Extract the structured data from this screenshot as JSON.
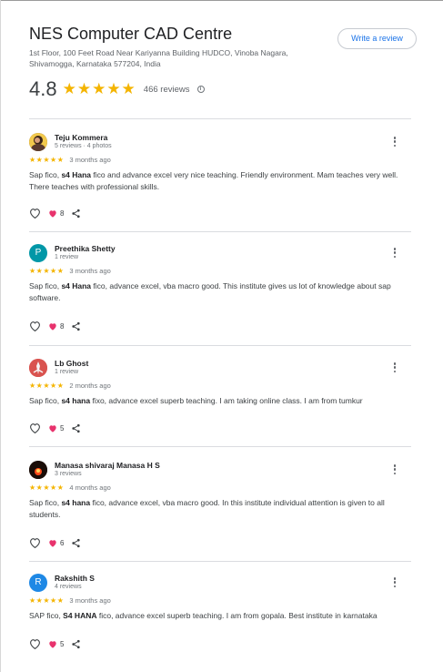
{
  "place": {
    "title": "NES Computer CAD Centre",
    "address": "1st Floor, 100 Feet Road Near Kariyanna Building HUDCO, Vinoba Nagara, Shivamogga, Karnataka 577204, India",
    "write_review_label": "Write a review",
    "rating": "4.8",
    "stars": "★★★★★",
    "reviews_count": "466 reviews",
    "info_symbol": "i"
  },
  "colors": {
    "accent": "#1a73e8",
    "star": "#f4b400",
    "heart": "#e8336d"
  },
  "reviews": [
    {
      "name": "Teju Kommera",
      "meta": "5 reviews · 4 photos",
      "avatar_type": "photo",
      "avatar_letter": "",
      "avatar_color": "#5a3a2e",
      "stars": "★★★★★",
      "time": "3 months ago",
      "text_pre": "Sap fico, ",
      "text_bold": "s4 Hana",
      "text_post": " fico and advance excel very nice teaching. Friendly environment. Mam teaches very well. There teaches with professional skills.",
      "likes": "8"
    },
    {
      "name": "Preethika Shetty",
      "meta": "1 review",
      "avatar_type": "letter",
      "avatar_letter": "P",
      "avatar_color": "#0097a7",
      "stars": "★★★★★",
      "time": "3 months ago",
      "text_pre": "Sap fico, ",
      "text_bold": "s4 Hana",
      "text_post": " fico, advance excel, vba macro good. This institute gives us lot of knowledge about sap software.",
      "likes": "8"
    },
    {
      "name": "Lb Ghost",
      "meta": "1 review",
      "avatar_type": "photo",
      "avatar_letter": "",
      "avatar_color": "#d9534f",
      "stars": "★★★★★",
      "time": "2 months ago",
      "text_pre": "Sap fico, ",
      "text_bold": "s4 hana",
      "text_post": " fixo, advance excel superb teaching. I am taking online class. I am from tumkur",
      "likes": "5"
    },
    {
      "name": "Manasa shivaraj Manasa H S",
      "meta": "3 reviews",
      "avatar_type": "photo",
      "avatar_letter": "",
      "avatar_color": "#1a0d08",
      "stars": "★★★★★",
      "time": "4 months ago",
      "text_pre": "Sap fico, ",
      "text_bold": "s4 hana",
      "text_post": " fico, advance excel, vba macro good. In this institute individual attention is given to all students.",
      "likes": "6"
    },
    {
      "name": "Rakshith S",
      "meta": "4 reviews",
      "avatar_type": "letter",
      "avatar_letter": "R",
      "avatar_color": "#1e88e5",
      "stars": "★★★★★",
      "time": "3 months ago",
      "text_pre": "SAP fico, ",
      "text_bold": "S4 HANA",
      "text_post": " fico, advance excel superb teaching. I am from gopala. Best institute in karnataka",
      "likes": "5"
    }
  ]
}
